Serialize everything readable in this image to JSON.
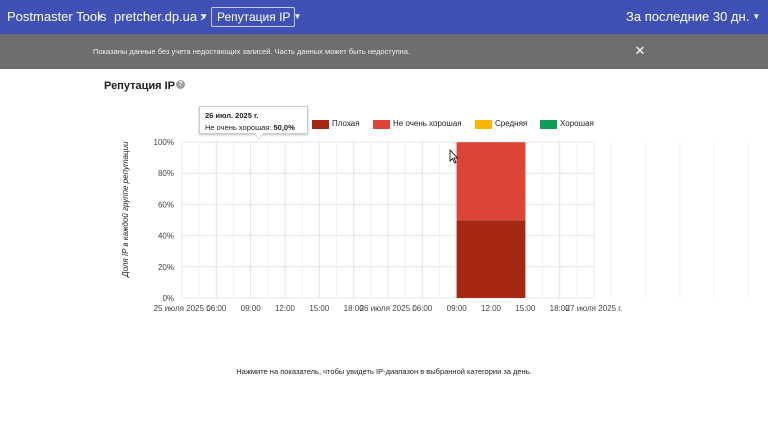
{
  "topbar": {
    "app_title": "Postmaster Tools",
    "breadcrumb_sep": "›",
    "domain": "pretcher.dp.ua",
    "page": "Репутация IP",
    "period": "За последние 30 дн."
  },
  "notice": {
    "text": "Показаны данные без учета недостающих записей. Часть данных может быть недоступна.",
    "close_glyph": "✕"
  },
  "section": {
    "title": "Репутация IP",
    "help_glyph": "?"
  },
  "tooltip": {
    "date": "26 июл. 2025 г.",
    "label": "Не очень хорошая:",
    "value": "50,0%"
  },
  "colors": {
    "topbar": "#3f51b5",
    "bad": "#a52714",
    "not_good": "#db4437",
    "medium": "#f4b400",
    "good": "#0f9d58"
  },
  "chart_data": {
    "type": "area",
    "stacked": true,
    "ylabel": "Доля IP в каждой группе репутации",
    "y_ticks": [
      "0%",
      "20%",
      "40%",
      "60%",
      "80%",
      "100%"
    ],
    "ylim": [
      0,
      100
    ],
    "x_ticks": [
      "25 июля 2025 г.",
      "06:00",
      "09:00",
      "12:00",
      "15:00",
      "18:00",
      "26 июля 2025 г.",
      "06:00",
      "09:00",
      "12:00",
      "15:00",
      "18:00",
      "27 июля 2025 г."
    ],
    "x": [
      "26 июля 2025 г. 09:00",
      "26 июля 2025 г. 15:00"
    ],
    "legend_position": "top-right",
    "series": [
      {
        "name": "Плохая",
        "color": "#a52714",
        "values": [
          50,
          50
        ]
      },
      {
        "name": "Не очень хорошая",
        "color": "#db4437",
        "values": [
          50,
          50
        ]
      },
      {
        "name": "Средняя",
        "color": "#f4b400",
        "values": [
          0,
          0
        ]
      },
      {
        "name": "Хорошая",
        "color": "#0f9d58",
        "values": [
          0,
          0
        ]
      }
    ],
    "grid": true
  },
  "footer": {
    "text": "Нажмите на показатель, чтобы увидеть IP-диапазон в выбранной категории за день."
  }
}
